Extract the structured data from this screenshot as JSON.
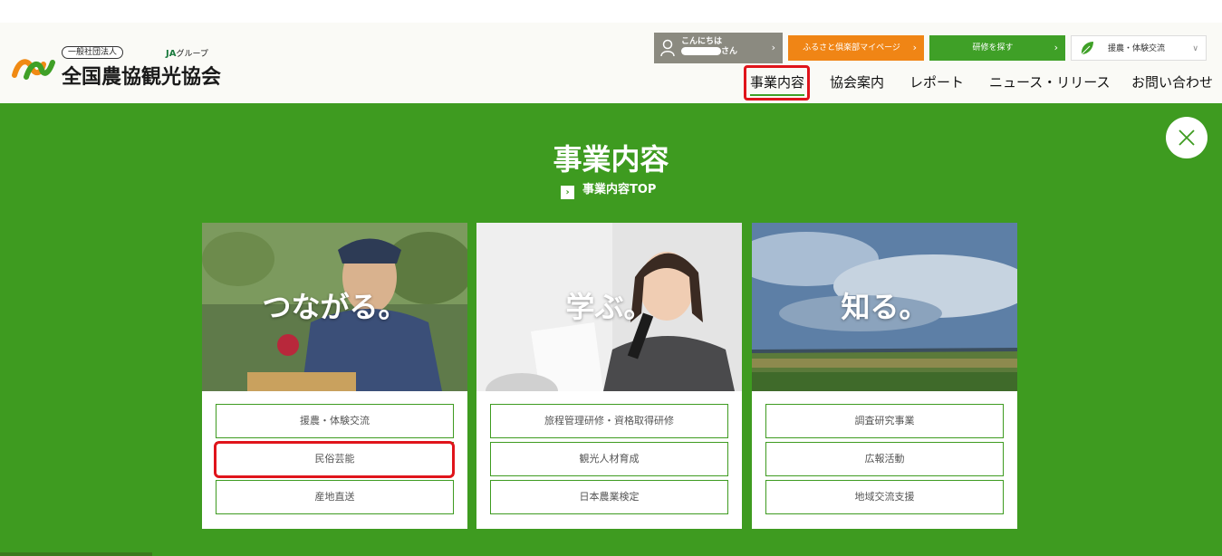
{
  "header": {
    "logo": {
      "small_label": "一般社団法人",
      "group_label_prefix": "JA",
      "group_label": "グループ",
      "name": "全国農協観光協会"
    },
    "user": {
      "greeting": "こんにちは",
      "name_suffix": "さん"
    },
    "mypage_label": "ふるさと倶楽部マイページ",
    "search_label": "研修を探す",
    "select_value": "援農・体験交流",
    "nav": [
      {
        "label": "事業内容"
      },
      {
        "label": "協会案内"
      },
      {
        "label": "レポート"
      },
      {
        "label": "ニュース・リリース"
      },
      {
        "label": "お問い合わせ"
      }
    ]
  },
  "panel": {
    "title": "事業内容",
    "top_link": "事業内容TOP",
    "cards": [
      {
        "heading": "つながる。",
        "links": [
          "援農・体験交流",
          "民俗芸能",
          "産地直送"
        ]
      },
      {
        "heading": "学ぶ。",
        "links": [
          "旅程管理研修・資格取得研修",
          "観光人材育成",
          "日本農業検定"
        ]
      },
      {
        "heading": "知る。",
        "links": [
          "調査研究事業",
          "広報活動",
          "地域交流支援"
        ]
      }
    ]
  },
  "colors": {
    "brand_green": "#3e9b20",
    "orange": "#f08515",
    "annotation_red": "#e0141b"
  }
}
